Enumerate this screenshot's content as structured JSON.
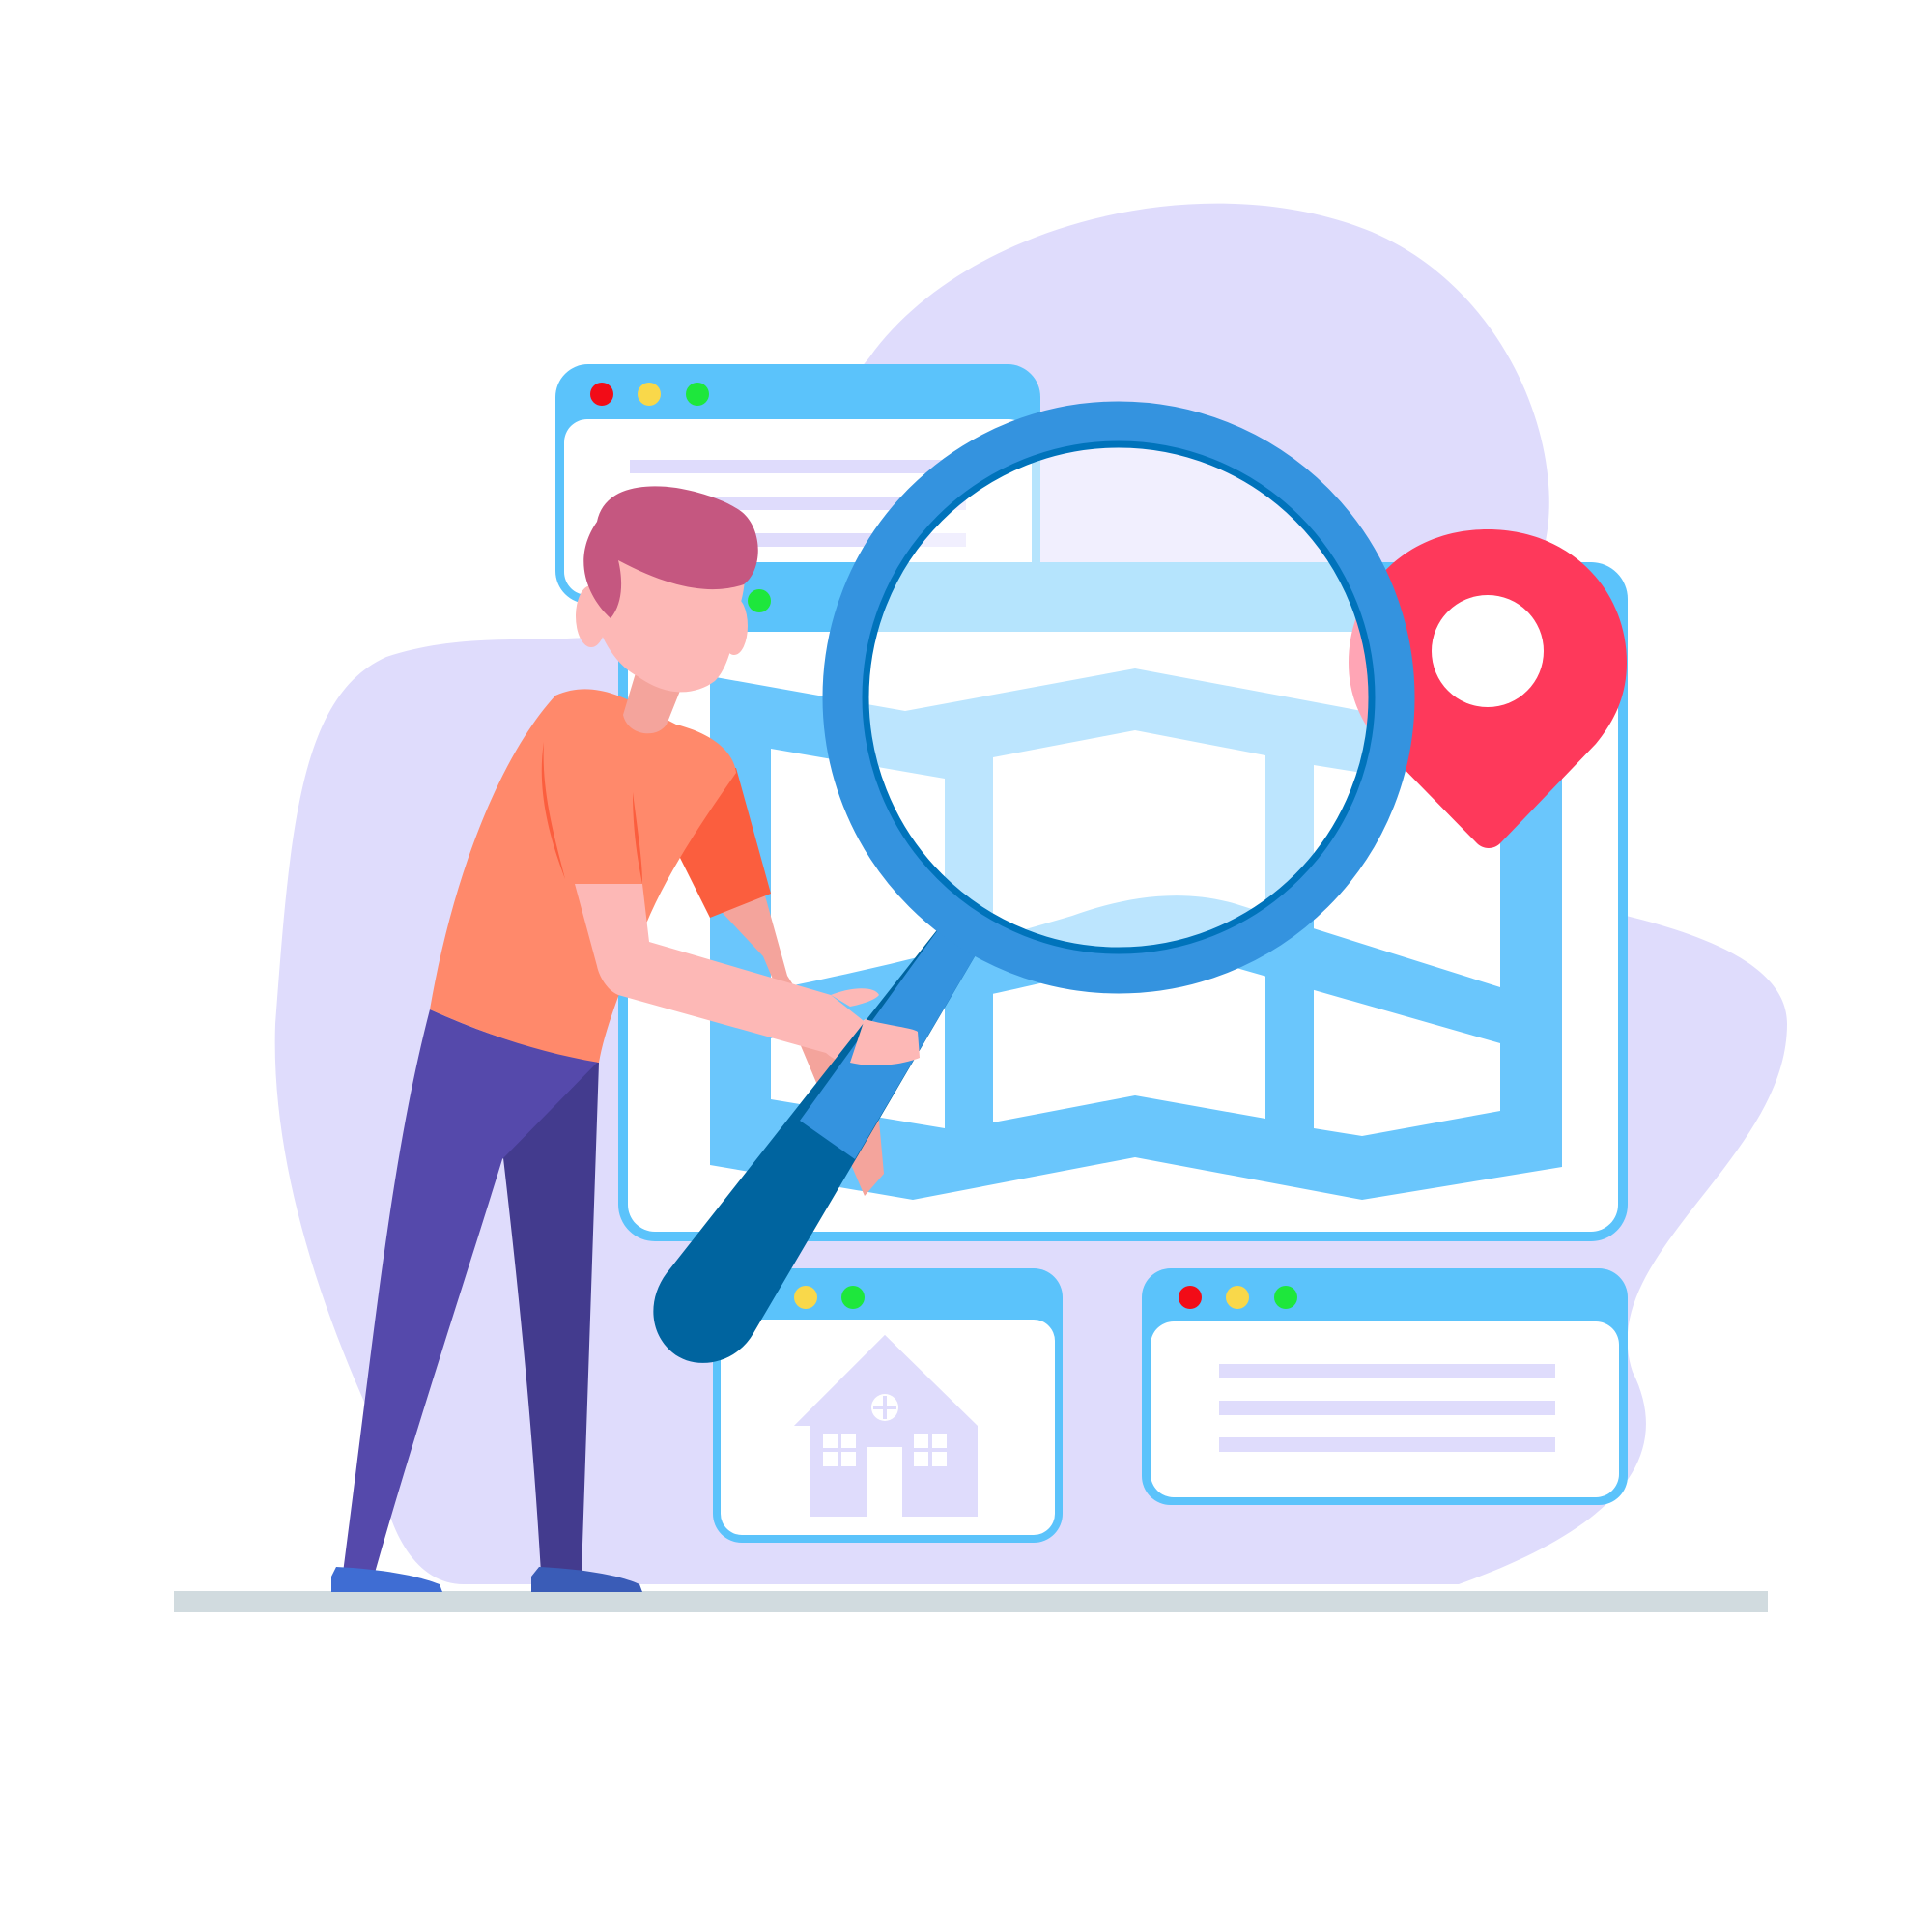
{
  "illustration": {
    "subject": "map-search",
    "colors": {
      "background": "#ffffff",
      "blob": "#dfdcfc",
      "window_frame": "#5bc3fb",
      "window_body": "#ffffff",
      "map_fill": "#6ac6fc",
      "dot_red": "#f20c17",
      "dot_yellow": "#f9d84a",
      "dot_green": "#1ee73c",
      "text_line": "#dfdcfc",
      "pin": "#fe395b",
      "lens_ring": "#3493df",
      "lens_ring_inner": "#0073bb",
      "lens_handle": "#00649f",
      "floor": "#d1dbdf",
      "hair": "#c55780",
      "skin": "#fdb8b6",
      "skin_shadow": "#f4a49c",
      "shirt": "#ff896b",
      "shirt_shade": "#fb5e3e",
      "pants": "#5549ab",
      "pants_shade": "#433b8e",
      "shoe": "#3f6dd3",
      "shoe_shade": "#3a5cb7"
    },
    "icons": {
      "location_pin": "map-pin-icon",
      "house": "house-icon",
      "magnifier": "magnifying-glass-icon"
    }
  }
}
